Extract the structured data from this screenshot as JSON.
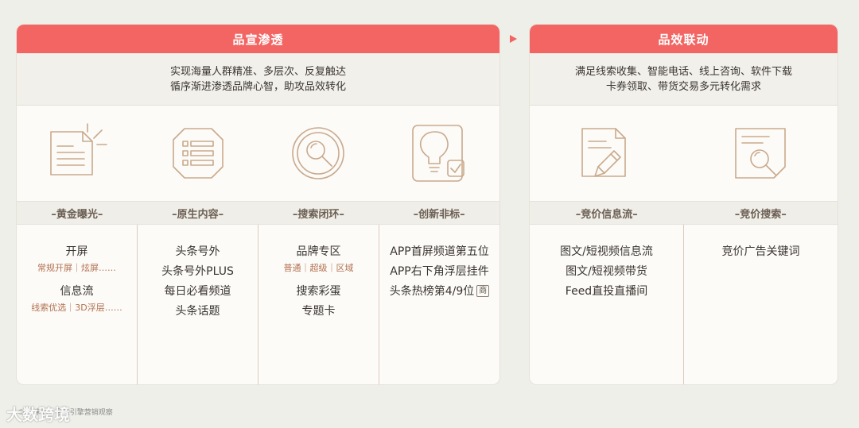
{
  "left": {
    "title": "品宣渗透",
    "desc_line1": "实现海量人群精准、多层次、反复触达",
    "desc_line2": "循序渐进渗透品牌心智，助攻品效转化",
    "columns": [
      {
        "icon": "document-spark-icon",
        "label": "–黄金曝光–",
        "items": [
          {
            "main": "开屏",
            "sub": "常规开屏｜炫屏……"
          },
          {
            "main": "信息流",
            "sub": "线索优选｜3D浮层……"
          }
        ]
      },
      {
        "icon": "list-card-icon",
        "label": "–原生内容–",
        "items": [
          {
            "main": "头条号外"
          },
          {
            "main": "头条号外PLUS"
          },
          {
            "main": "每日必看频道"
          },
          {
            "main": "头条话题"
          }
        ]
      },
      {
        "icon": "magnify-circle-icon",
        "label": "–搜索闭环–",
        "items": [
          {
            "main": "品牌专区",
            "sub": "普通｜超级｜区域"
          },
          {
            "main": "搜索彩蛋"
          },
          {
            "main": "专题卡"
          }
        ]
      },
      {
        "icon": "lightbulb-check-icon",
        "label": "–创新非标–",
        "items": [
          {
            "main": "APP首屏频道第五位"
          },
          {
            "main": "APP右下角浮层挂件"
          },
          {
            "main": "头条热榜第4/9位",
            "badge": "商"
          }
        ]
      }
    ]
  },
  "right": {
    "title": "品效联动",
    "desc_line1": "满足线索收集、智能电话、线上咨询、软件下载",
    "desc_line2": "卡券领取、带货交易多元转化需求",
    "columns": [
      {
        "icon": "document-pen-icon",
        "label": "–竞价信息流–",
        "items": [
          {
            "main": "图文/短视频信息流"
          },
          {
            "main": "图文/短视频带货"
          },
          {
            "main": "Feed直投直播间"
          }
        ]
      },
      {
        "icon": "document-search-icon",
        "label": "–竞价搜索–",
        "items": [
          {
            "main": "竞价广告关键词"
          }
        ]
      }
    ]
  },
  "watermark": "大数跨境",
  "watermark_small": "©PC来源：巨量引擎营销观察"
}
